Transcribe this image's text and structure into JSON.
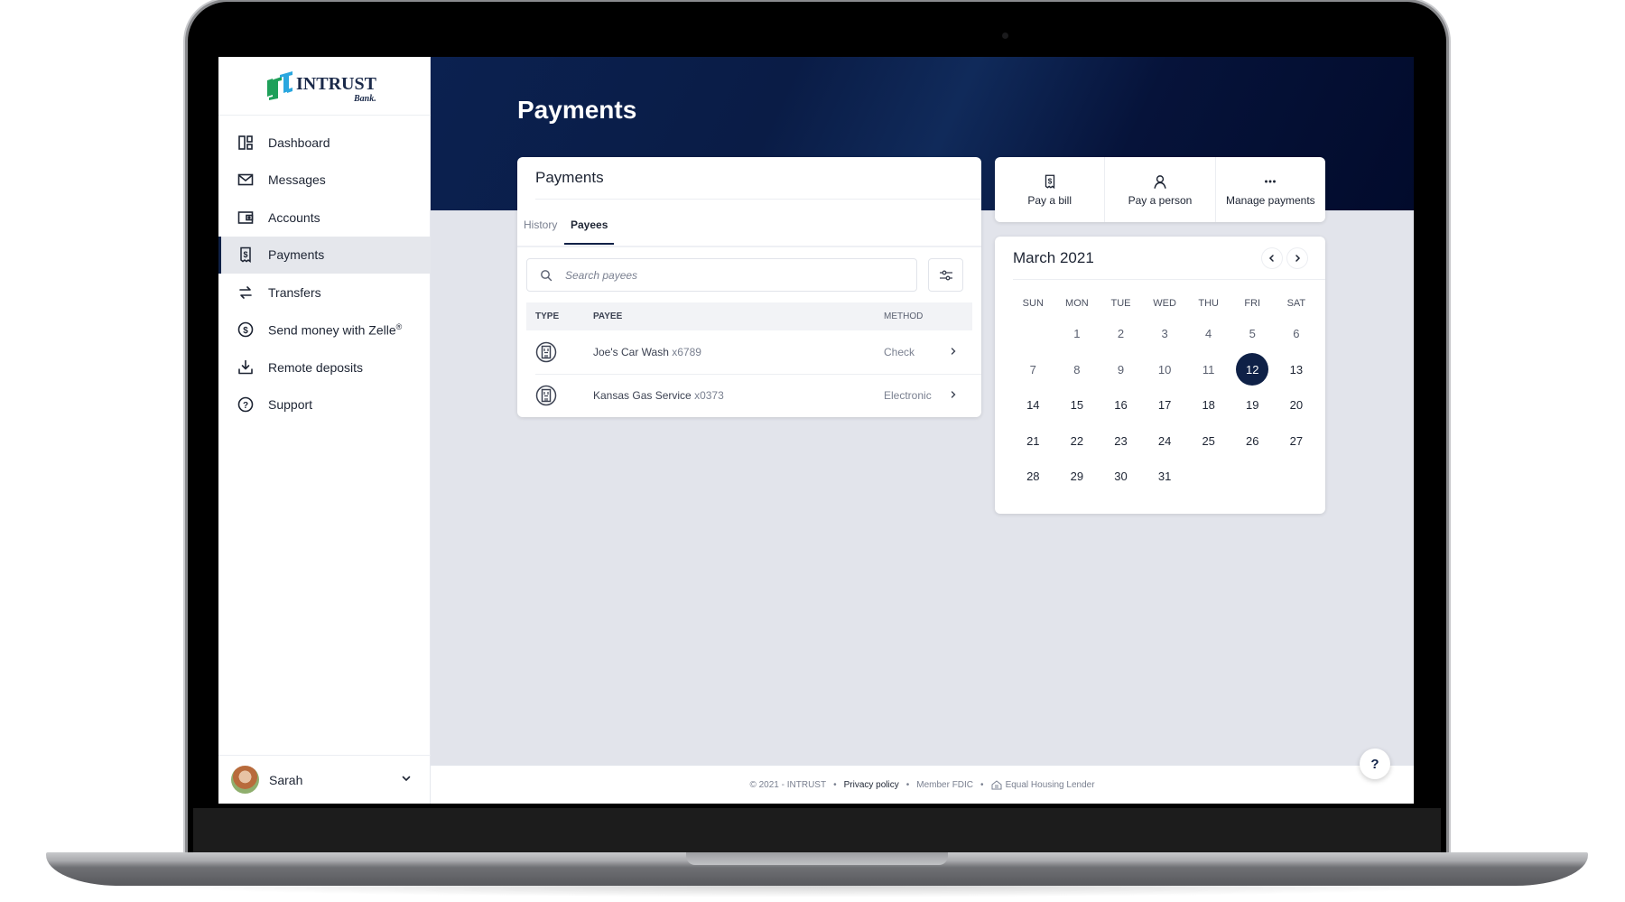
{
  "brand": {
    "name": "INTRUST",
    "sub": "Bank.",
    "colors": {
      "primary": "#0f2147",
      "logo_green": "#1fa05a",
      "logo_blue": "#2aa7df"
    }
  },
  "sidebar": {
    "items": [
      {
        "label": "Dashboard",
        "icon": "dashboard-icon",
        "active": false
      },
      {
        "label": "Messages",
        "icon": "envelope-icon",
        "active": false
      },
      {
        "label": "Accounts",
        "icon": "wallet-icon",
        "active": false
      },
      {
        "label": "Payments",
        "icon": "bill-icon",
        "active": true
      },
      {
        "label": "Transfers",
        "icon": "transfer-arrows-icon",
        "active": false
      },
      {
        "label": "Send money with Zelle",
        "sup": "®",
        "icon": "dollar-circle-icon",
        "active": false
      },
      {
        "label": "Remote deposits",
        "icon": "download-tray-icon",
        "active": false
      },
      {
        "label": "Support",
        "icon": "question-circle-icon",
        "active": false
      }
    ],
    "user": {
      "name": "Sarah"
    }
  },
  "header": {
    "title": "Payments"
  },
  "payments_card": {
    "title": "Payments",
    "tabs": [
      {
        "label": "History",
        "active": false
      },
      {
        "label": "Payees",
        "active": true
      }
    ],
    "search": {
      "placeholder": "Search payees",
      "value": ""
    },
    "columns": {
      "type": "TYPE",
      "payee": "PAYEE",
      "method": "METHOD"
    },
    "rows": [
      {
        "type_icon": "building-icon",
        "payee": "Joe's Car Wash",
        "account": "x6789",
        "method": "Check"
      },
      {
        "type_icon": "building-icon",
        "payee": "Kansas Gas Service",
        "account": "x0373",
        "method": "Electronic"
      }
    ]
  },
  "actions": [
    {
      "label": "Pay a bill",
      "icon": "bill-icon"
    },
    {
      "label": "Pay a person",
      "icon": "person-icon"
    },
    {
      "label": "Manage payments",
      "icon": "more-horizontal-icon"
    }
  ],
  "calendar": {
    "title": "March 2021",
    "weekdays": [
      "SUN",
      "MON",
      "TUE",
      "WED",
      "THU",
      "FRI",
      "SAT"
    ],
    "first_weekday_index": 1,
    "days_in_month": 31,
    "selected_day": 12
  },
  "footer": {
    "copyright": "© 2021 - INTRUST",
    "privacy": "Privacy policy",
    "fdic": "Member FDIC",
    "housing": "Equal Housing Lender",
    "separator": "•"
  },
  "help": {
    "label": "?"
  }
}
